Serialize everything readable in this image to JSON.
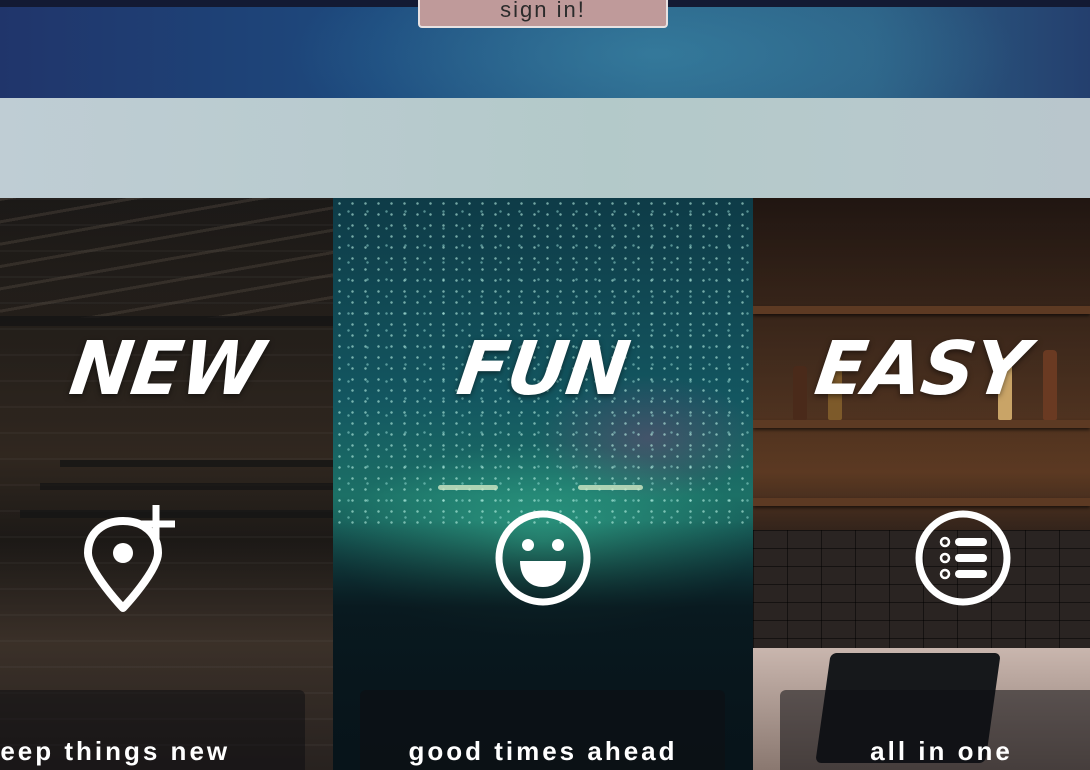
{
  "hero": {
    "signin_label": "sign in!"
  },
  "panels": [
    {
      "id": "new",
      "title": "NEW",
      "icon": "map-pin-plus-icon",
      "caption": "keep things new"
    },
    {
      "id": "fun",
      "title": "FUN",
      "icon": "laughing-face-icon",
      "caption": "good times ahead"
    },
    {
      "id": "easy",
      "title": "EASY",
      "icon": "list-circle-icon",
      "caption": "all in one"
    }
  ],
  "colors": {
    "text": "#ffffff",
    "signin_button_bg": "#bf9a9a",
    "hero_bg": "#1d4a7e",
    "band_bg": "#b7c9cc"
  }
}
